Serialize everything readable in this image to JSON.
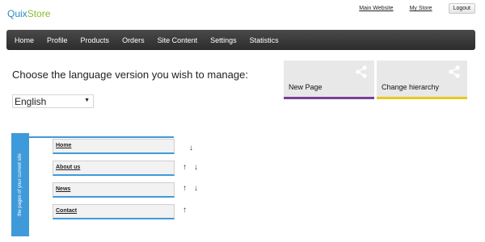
{
  "logo": {
    "part1": "Quix",
    "part2": "Store"
  },
  "toplinks": {
    "main_website": "Main Website",
    "my_store": "My Store",
    "logout": "Logout"
  },
  "nav": [
    "Home",
    "Profile",
    "Products",
    "Orders",
    "Site Content",
    "Settings",
    "Statistics"
  ],
  "prompt": "Choose the language version you wish to manage:",
  "language": {
    "selected": "English"
  },
  "tiles": [
    {
      "label": "New Page",
      "accent": "#7b3f99"
    },
    {
      "label": "Change hierarchy",
      "accent": "#e6c81e"
    }
  ],
  "pages_tab_label": "the pages of your current site",
  "pages": [
    {
      "label": "Home",
      "arrows": [
        "down"
      ]
    },
    {
      "label": "About us",
      "arrows": [
        "up",
        "down"
      ]
    },
    {
      "label": "News",
      "arrows": [
        "up",
        "down"
      ]
    },
    {
      "label": "Contact",
      "arrows": [
        "up"
      ]
    }
  ],
  "colors": {
    "accent_blue": "#3f9ad9",
    "logo_blue": "#2c87c9",
    "logo_green": "#8cbb2e"
  },
  "icons": {
    "tile_icon": "share-icon",
    "move_up": "arrow-up-icon",
    "move_down": "arrow-down-icon"
  }
}
